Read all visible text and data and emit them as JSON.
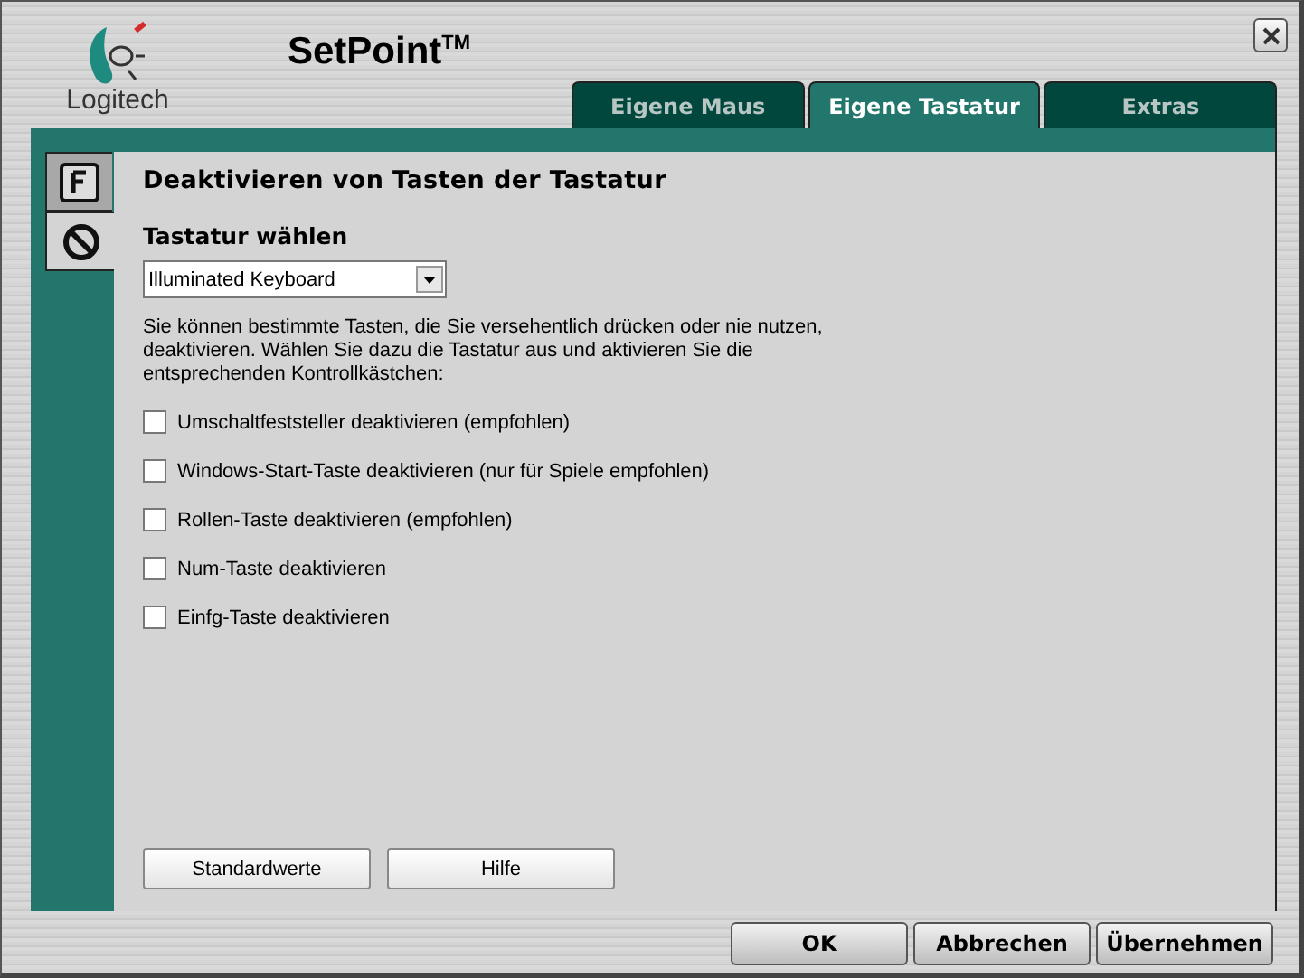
{
  "app": {
    "brand": "Logitech",
    "title": "SetPoint$^{TM}$"
  },
  "tabs": [
    {
      "label": "Eigene Maus",
      "selected": false
    },
    {
      "label": "Eigene Tastatur",
      "selected": true
    },
    {
      "label": "Extras",
      "selected": false
    }
  ],
  "side_tabs": [
    {
      "kind": "function-key",
      "selected": false
    },
    {
      "kind": "prohibited",
      "selected": true
    }
  ],
  "page": {
    "heading": "Deaktivieren von Tasten der Tastatur",
    "keyboard_label": "Tastatur wählen",
    "keyboard_value": "Illuminated Keyboard",
    "description": "Sie können bestimmte Tasten, die Sie versehentlich drücken oder nie nutzen, deaktivieren. Wählen Sie dazu die Tastatur aus und aktivieren Sie die entsprechenden Kontrollkästchen:"
  },
  "options": [
    {
      "label": "Umschaltfeststeller deaktivieren (empfohlen)",
      "checked": false
    },
    {
      "label": "Windows-Start-Taste deaktivieren (nur für Spiele empfohlen)",
      "checked": false
    },
    {
      "label": "Rollen-Taste deaktivieren (empfohlen)",
      "checked": false
    },
    {
      "label": "Num-Taste deaktivieren",
      "checked": false
    },
    {
      "label": "Einfg-Taste deaktivieren",
      "checked": false
    }
  ],
  "page_buttons": [
    "Standardwerte",
    "Hilfe"
  ],
  "dialog_buttons": [
    "OK",
    "Abbrechen",
    "Übernehmen"
  ]
}
